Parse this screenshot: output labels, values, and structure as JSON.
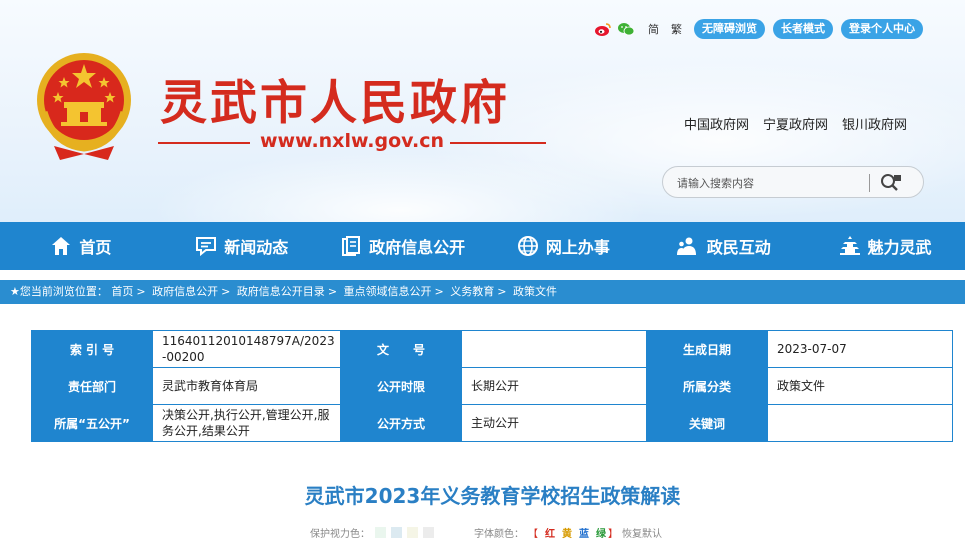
{
  "header": {
    "title": "灵武市人民政府",
    "domain": "www.nxlw.gov.cn",
    "lang_simplified": "简",
    "lang_traditional": "繁",
    "pills": [
      "无障碍浏览",
      "长者模式",
      "登录个人中心"
    ],
    "gov_links": [
      "中国政府网",
      "宁夏政府网",
      "银川政府网"
    ],
    "search_placeholder": "请输入搜索内容",
    "icons": [
      "weibo-icon",
      "wechat-icon",
      "search-icon"
    ],
    "colors": {
      "title_red": "#d42b1e",
      "nav_blue": "#1f85cf",
      "pill_blue": "#3aa3e6"
    }
  },
  "nav": {
    "items": [
      {
        "label": "首页",
        "icon": "home-icon"
      },
      {
        "label": "新闻动态",
        "icon": "chat-icon"
      },
      {
        "label": "政府信息公开",
        "icon": "document-icon"
      },
      {
        "label": "网上办事",
        "icon": "globe-icon"
      },
      {
        "label": "政民互动",
        "icon": "people-icon"
      },
      {
        "label": "魅力灵武",
        "icon": "pagoda-icon"
      }
    ]
  },
  "breadcrumb": {
    "prefix": "★您当前浏览位置：",
    "items": [
      "首页",
      "政府信息公开",
      "政府信息公开目录",
      "重点领域信息公开",
      "义务教育",
      "政策文件"
    ],
    "separator": ">"
  },
  "info": {
    "rows": [
      [
        {
          "key": "索 引 号",
          "value": "11640112010148797A/2023-00200"
        },
        {
          "key": "文　　号",
          "value": ""
        },
        {
          "key": "生成日期",
          "value": "2023-07-07"
        }
      ],
      [
        {
          "key": "责任部门",
          "value": "灵武市教育体育局"
        },
        {
          "key": "公开时限",
          "value": "长期公开"
        },
        {
          "key": "所属分类",
          "value": "政策文件"
        }
      ],
      [
        {
          "key": "所属“五公开”",
          "value": "决策公开,执行公开,管理公开,服务公开,结果公开"
        },
        {
          "key": "公开方式",
          "value": "主动公开"
        },
        {
          "key": "关键词",
          "value": ""
        }
      ]
    ]
  },
  "article": {
    "title": "灵武市2023年义务教育学校招生政策解读",
    "eye_label": "保护视力色：",
    "eye_colors": [
      "#eaf6ee",
      "#dceaf1",
      "#f5f5e6",
      "#ececec"
    ],
    "font_label": "字体颜色：",
    "font_colors": [
      {
        "label": "红",
        "color": "#d42b1e"
      },
      {
        "label": "黄",
        "color": "#d79a00"
      },
      {
        "label": "蓝",
        "color": "#1f6fcf"
      },
      {
        "label": "绿",
        "color": "#2a9a3a"
      }
    ],
    "bracket_open": "【",
    "bracket_close": "】",
    "restore_label": "恢复默认"
  }
}
